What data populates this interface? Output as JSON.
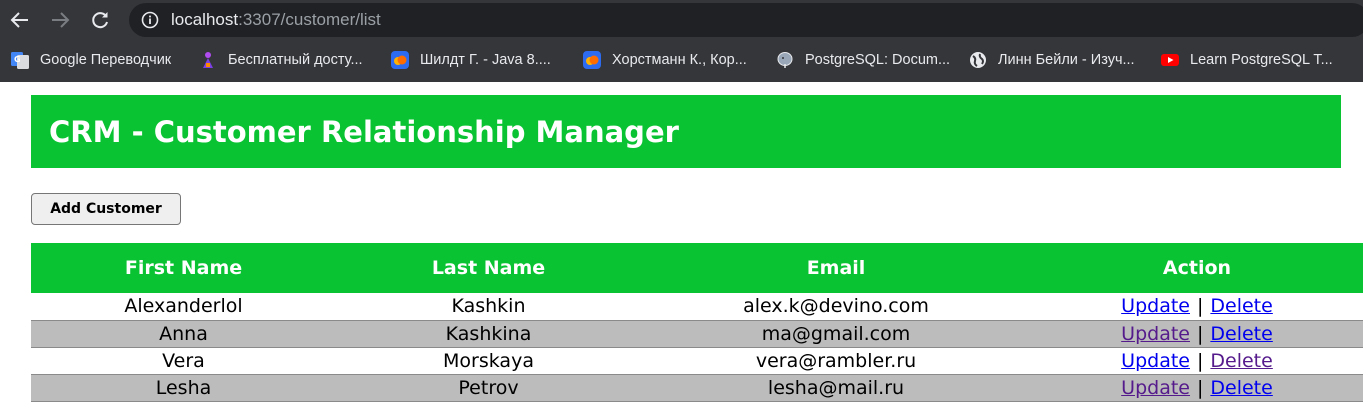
{
  "browser": {
    "url_host": "localhost",
    "url_path": ":3307/customer/list",
    "bookmarks": [
      {
        "label": "Google Переводчик",
        "icon": "google-translate-icon"
      },
      {
        "label": "Бесплатный досту...",
        "icon": "purple-person-icon"
      },
      {
        "label": "Шилдт Г. - Java 8....",
        "icon": "cloud-books-icon"
      },
      {
        "label": "Хорстманн К., Кор...",
        "icon": "cloud-books-icon"
      },
      {
        "label": "PostgreSQL: Docum...",
        "icon": "postgresql-elephant-icon"
      },
      {
        "label": "Линн Бейли - Изуч...",
        "icon": "globe-icon"
      },
      {
        "label": "Learn PostgreSQL T...",
        "icon": "youtube-icon"
      }
    ]
  },
  "page": {
    "title": "CRM - Customer Relationship Manager",
    "add_button": "Add Customer",
    "accent_color": "#09c332"
  },
  "table": {
    "headers": [
      "First Name",
      "Last Name",
      "Email",
      "Action"
    ],
    "rows": [
      {
        "first": "Alexanderlol",
        "last": "Kashkin",
        "email": "alex.k@devino.com",
        "update": "Update",
        "delete": "Delete"
      },
      {
        "first": "Anna",
        "last": "Kashkina",
        "email": "ma@gmail.com",
        "update": "Update",
        "delete": "Delete"
      },
      {
        "first": "Vera",
        "last": "Morskaya",
        "email": "vera@rambler.ru",
        "update": "Update",
        "delete": "Delete"
      },
      {
        "first": "Lesha",
        "last": "Petrov",
        "email": "lesha@mail.ru",
        "update": "Update",
        "delete": "Delete"
      }
    ],
    "separator": "|"
  }
}
